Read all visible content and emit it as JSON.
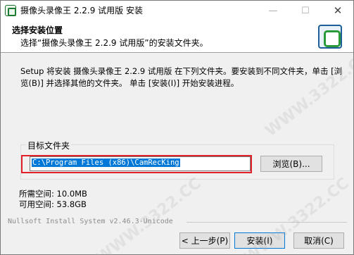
{
  "window": {
    "title": "摄像头录像王 2.2.9 试用版 安装",
    "minimize_glyph": "—",
    "maximize_glyph": "☐",
    "close_glyph": "✕"
  },
  "header": {
    "title": "选择安装位置",
    "subtitle": "选择“摄像头录像王 2.2.9 试用版”的安装文件夹。"
  },
  "body": {
    "intro": "Setup 将安装 摄像头录像王 2.2.9 试用版 在下列文件夹。要安装到不同文件夹，单击 [浏览(B)] 并选择其他的文件夹。 单击 [安装(I)] 开始安装进程。",
    "group_label": "目标文件夹",
    "path_value": "C:\\Program Files (x86)\\CamRecKing",
    "browse_label": "浏览(B)...",
    "space_required": "所需空间: 10.0MB",
    "space_available": "可用空间: 53.8GB"
  },
  "footer": {
    "brand": "Nullsoft Install System v2.46.3-Unicode",
    "back_label": "< 上一步(P)",
    "install_label": "安装(I)",
    "cancel_label": "取消(C)"
  },
  "watermark_text": "WWW.3322.CC",
  "colors": {
    "selection": "#0078d7",
    "highlight_box": "#e0202a",
    "logo_green": "#2b9a3a"
  }
}
